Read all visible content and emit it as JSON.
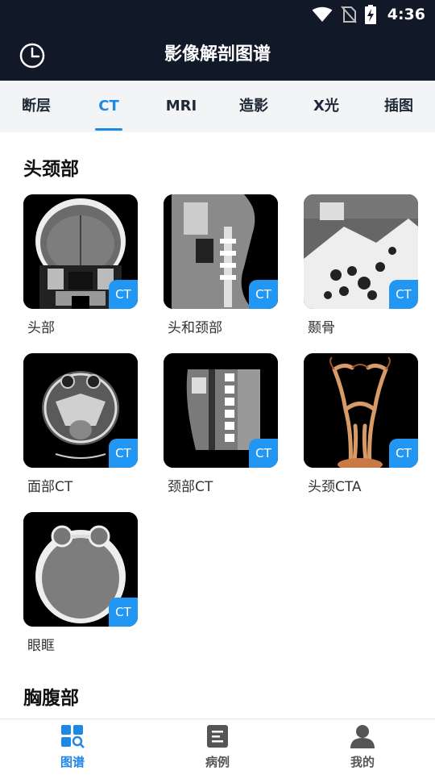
{
  "status_bar": {
    "time": "4:36"
  },
  "app_bar": {
    "title": "影像解剖图谱"
  },
  "tabs": [
    {
      "label": "断层",
      "active": false
    },
    {
      "label": "CT",
      "active": true
    },
    {
      "label": "MRI",
      "active": false
    },
    {
      "label": "造影",
      "active": false
    },
    {
      "label": "X光",
      "active": false
    },
    {
      "label": "插图",
      "active": false
    }
  ],
  "sections": [
    {
      "title": "头颈部",
      "items": [
        {
          "label": "头部",
          "badge": "CT",
          "image": "head-coronal-ct"
        },
        {
          "label": "头和颈部",
          "badge": "CT",
          "image": "head-neck-sagittal-ct"
        },
        {
          "label": "颞骨",
          "badge": "CT",
          "image": "temporal-bone-ct"
        },
        {
          "label": "面部CT",
          "badge": "CT",
          "image": "face-axial-ct"
        },
        {
          "label": "颈部CT",
          "badge": "CT",
          "image": "neck-sagittal-ct"
        },
        {
          "label": "头颈CTA",
          "badge": "CT",
          "image": "head-neck-cta"
        },
        {
          "label": "眼眶",
          "badge": "CT",
          "image": "orbit-axial-ct"
        }
      ]
    },
    {
      "title": "胸腹部",
      "items": []
    }
  ],
  "bottom_nav": [
    {
      "label": "图谱",
      "icon": "atlas-grid-search-icon",
      "active": true
    },
    {
      "label": "病例",
      "icon": "case-document-icon",
      "active": false
    },
    {
      "label": "我的",
      "icon": "profile-person-icon",
      "active": false
    }
  ],
  "colors": {
    "bars": "#111827",
    "accent": "#1e88e5",
    "badge": "#2196f3"
  }
}
